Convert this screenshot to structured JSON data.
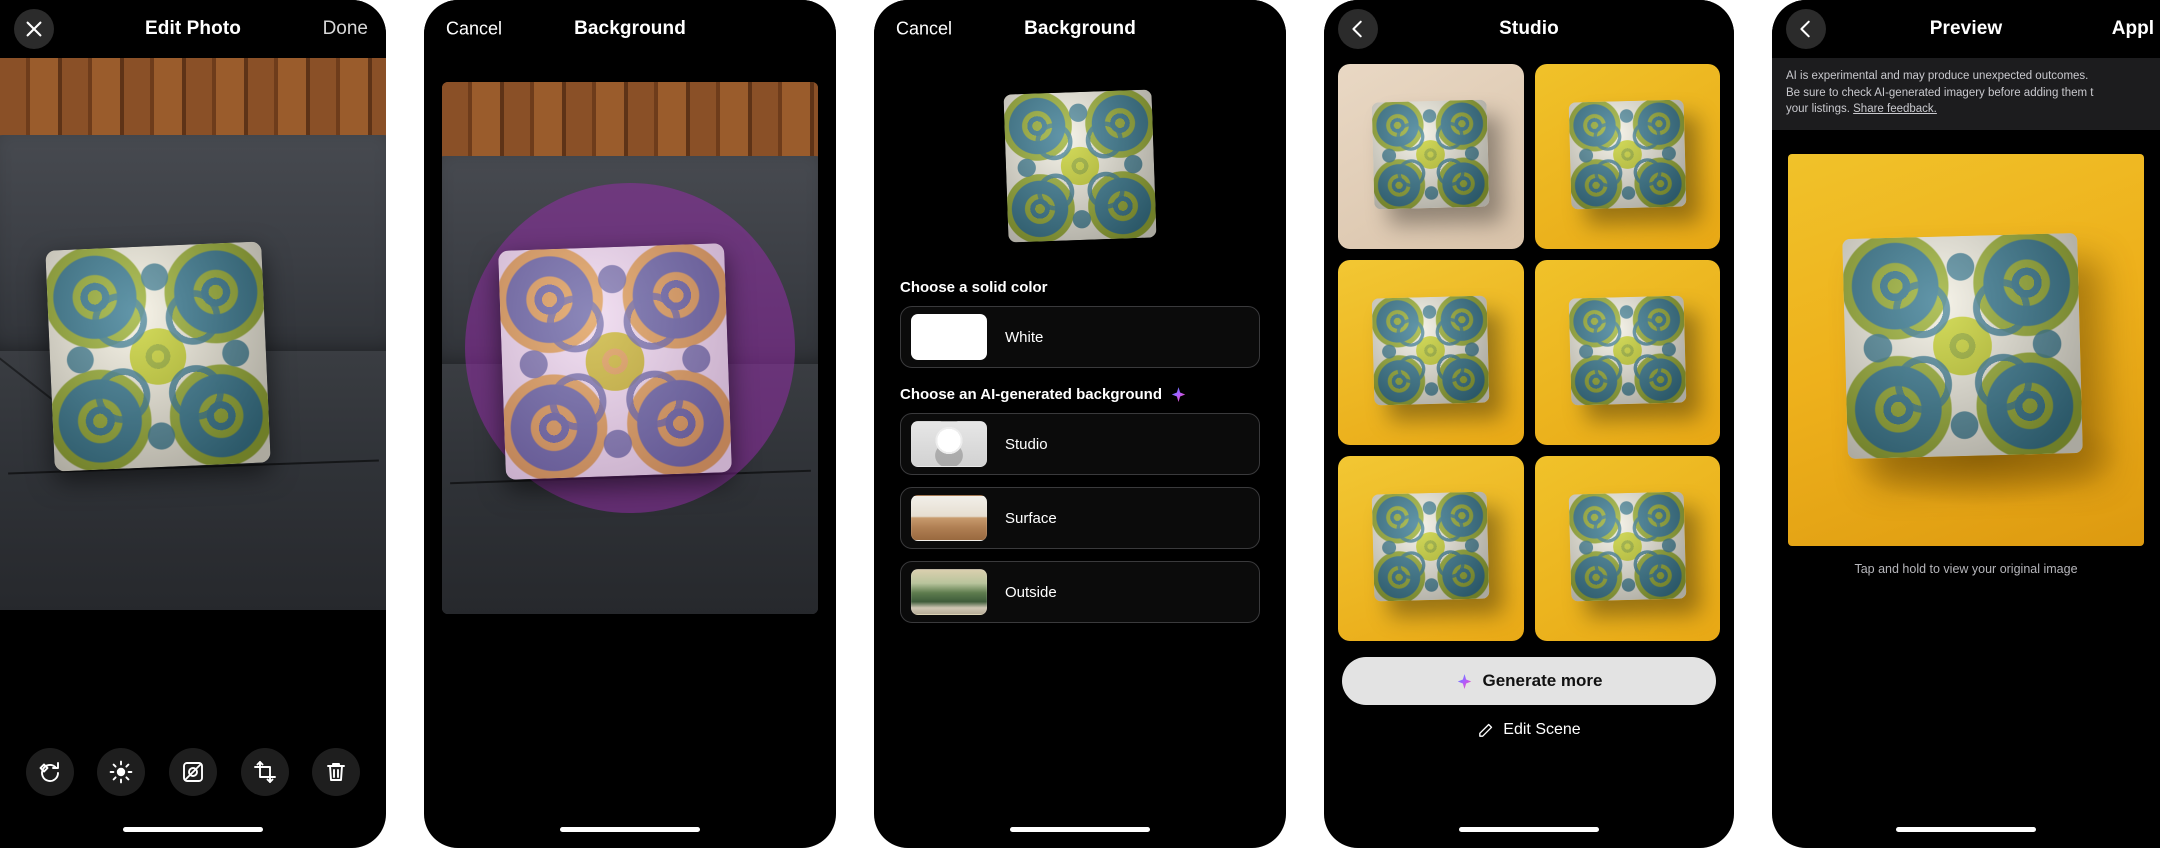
{
  "panels": {
    "edit_photo": {
      "nav": {
        "close_icon": "close-icon",
        "title": "Edit Photo",
        "done_label": "Done"
      },
      "tools": [
        {
          "name": "rotate-tool",
          "icon": "rotate-icon"
        },
        {
          "name": "brightness-tool",
          "icon": "brightness-icon"
        },
        {
          "name": "background-tool",
          "icon": "background-icon"
        },
        {
          "name": "crop-tool",
          "icon": "crop-icon"
        },
        {
          "name": "delete-tool",
          "icon": "trash-icon"
        }
      ]
    },
    "background_brush": {
      "nav": {
        "cancel_label": "Cancel",
        "title": "Background"
      }
    },
    "background_options": {
      "nav": {
        "cancel_label": "Cancel",
        "title": "Background"
      },
      "solid_section_title": "Choose a solid color",
      "solid_options": [
        {
          "label": "White",
          "color": "#ffffff"
        }
      ],
      "ai_section_title": "Choose an AI-generated background",
      "ai_sparkle_icon": "sparkle-icon",
      "ai_options": [
        {
          "label": "Studio"
        },
        {
          "label": "Surface"
        },
        {
          "label": "Outside"
        }
      ]
    },
    "studio": {
      "nav": {
        "back_icon": "chevron-left-icon",
        "title": "Studio"
      },
      "results": [
        {
          "name": "studio-result-1",
          "bg": "#ddc5ab"
        },
        {
          "name": "studio-result-2",
          "bg": "#edb71d"
        },
        {
          "name": "studio-result-3",
          "bg": "#edb71d"
        },
        {
          "name": "studio-result-4",
          "bg": "#edb71d"
        },
        {
          "name": "studio-result-5",
          "bg": "#edb71d"
        },
        {
          "name": "studio-result-6",
          "bg": "#edb71d"
        }
      ],
      "generate_more_label": "Generate more",
      "generate_more_icon": "sparkle-icon",
      "edit_scene_label": "Edit Scene",
      "edit_scene_icon": "pencil-icon"
    },
    "preview": {
      "nav": {
        "back_icon": "chevron-left-icon",
        "title": "Preview",
        "apply_label": "Appl"
      },
      "disclaimer_line1": "AI is experimental and may produce unexpected outcomes.",
      "disclaimer_line2": "Be sure to check AI-generated imagery before adding them t",
      "disclaimer_line3": "your listings.",
      "disclaimer_link": "Share feedback.",
      "caption": "Tap and hold to view your original image"
    }
  },
  "colors": {
    "accent_amber": "#edb71d",
    "brush_purple": "#962daa",
    "card_border": "#3a3a3c",
    "panel_bg": "#000000"
  }
}
